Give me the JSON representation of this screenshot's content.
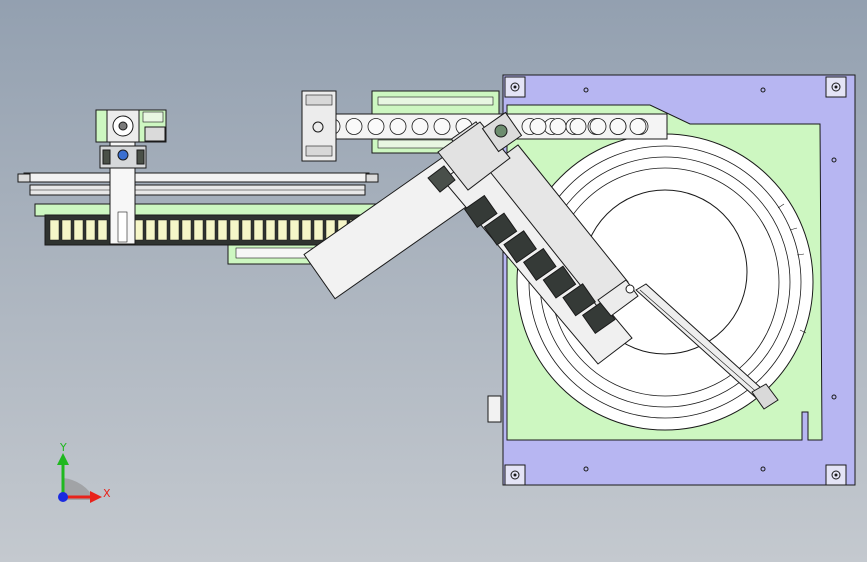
{
  "viewport": {
    "background_top": "#93a0b0",
    "background_bottom": "#c4c9cf"
  },
  "colors": {
    "plate_purple": "#b7b6f2",
    "plate_green": "#cdf7c1",
    "steel_gray": "#c9cccf",
    "dark_body": "#3a3f3c",
    "outline": "#1a1a1a",
    "axis_x": "#e8221a",
    "axis_y": "#1fb81f",
    "axis_z": "#1a2ae0"
  },
  "triad": {
    "x_label": "X",
    "y_label": "Y",
    "icon": "coordinate-triad-icon"
  },
  "components": {
    "base_plate": "base-plate",
    "bowl": "vibratory-bowl",
    "conveyor": "conveyor-belt",
    "gantry": "linear-gantry",
    "motor": "servo-motor-icon",
    "arm": "inclined-feeder-arm",
    "rod": "push-rod"
  }
}
